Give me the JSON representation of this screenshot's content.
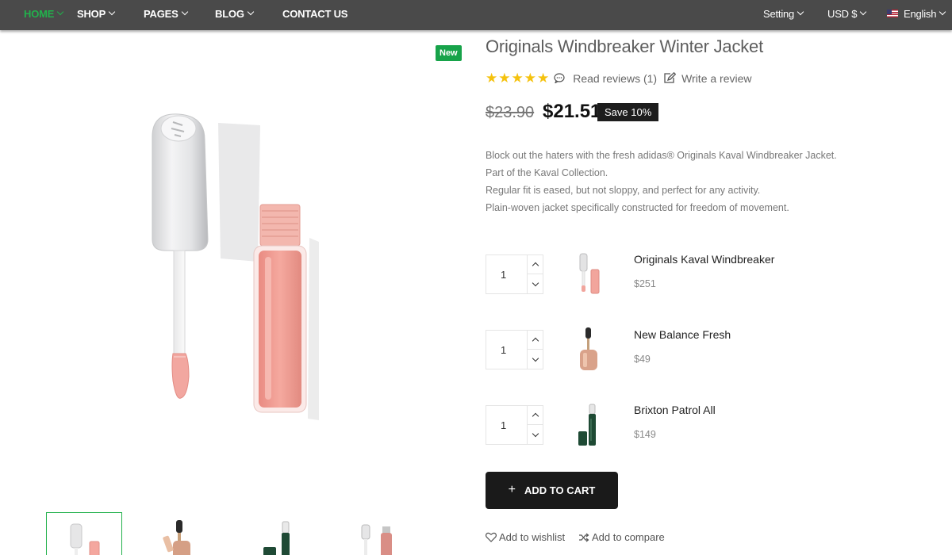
{
  "nav": {
    "items": [
      {
        "label": "HOME"
      },
      {
        "label": "SHOP"
      },
      {
        "label": "PAGES"
      },
      {
        "label": "BLOG"
      },
      {
        "label": "CONTACT US"
      }
    ],
    "setting": "Setting",
    "currency": "USD $",
    "language": "English"
  },
  "product": {
    "badge": "New",
    "title": "Originals Windbreaker Winter Jacket",
    "rating": 5,
    "read_reviews": "Read reviews (1)",
    "write_review": "Write a review",
    "old_price": "$23.90",
    "price": "$21.51",
    "save": "Save 10%",
    "description": [
      "Block out the haters with the fresh adidas® Originals Kaval Windbreaker Jacket.",
      "Part of the Kaval Collection.",
      "Regular fit is eased, but not sloppy, and perfect for any activity.",
      "Plain-woven jacket specifically constructed for freedom of movement."
    ]
  },
  "bundle": [
    {
      "qty": "1",
      "name": "Originals Kaval Windbreaker",
      "price": "$251",
      "thumb": "lip-gloss-icon"
    },
    {
      "qty": "1",
      "name": "New Balance Fresh",
      "price": "$49",
      "thumb": "dropper-bottle-icon"
    },
    {
      "qty": "1",
      "name": "Brixton Patrol All",
      "price": "$149",
      "thumb": "serum-bottle-icon"
    }
  ],
  "actions": {
    "add_to_cart": "ADD TO CART",
    "wishlist": "Add to wishlist",
    "compare": "Add to compare"
  },
  "colors": {
    "accent": "#22b14c",
    "nav_bg": "#4a4a4a",
    "star": "#f5c20e",
    "button": "#1a1a1a"
  }
}
